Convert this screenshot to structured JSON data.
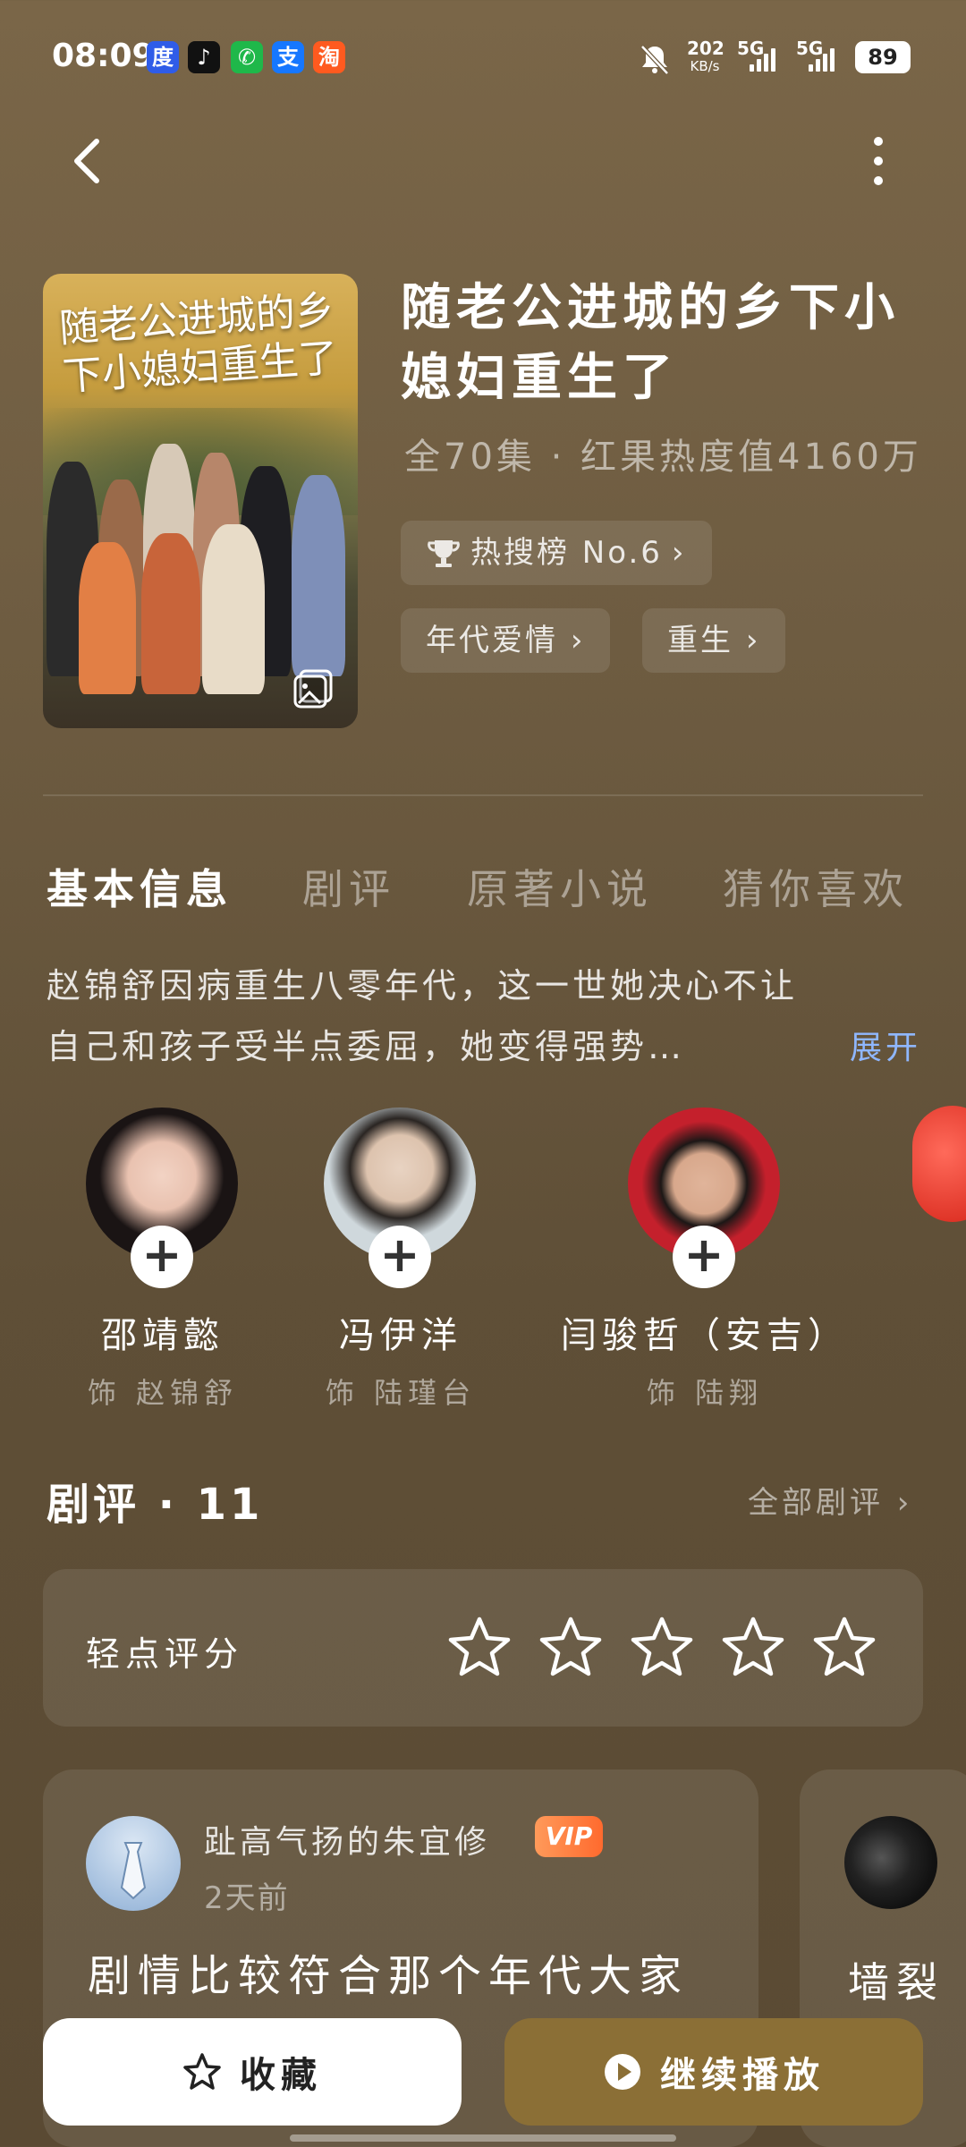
{
  "status_bar": {
    "time": "08:09",
    "apps": [
      "baidu-icon",
      "douyin-icon",
      "wechat-icon",
      "alipay-icon",
      "taobao-icon"
    ],
    "net_speed_value": "202",
    "net_speed_unit": "KB/s",
    "sim1": "5G",
    "sim2": "5G",
    "battery": "89"
  },
  "show": {
    "title": "随老公进城的乡下小媳妇重生了",
    "poster_title": "随老公进城的乡下小媳妇重生了",
    "meta": "全70集 · 红果热度值4160万",
    "rank_chip": "热搜榜 No.6",
    "tags": [
      "年代爱情",
      "重生"
    ]
  },
  "tabs": [
    "基本信息",
    "剧评",
    "原著小说",
    "猜你喜欢"
  ],
  "synopsis": {
    "line1": "赵锦舒因病重生八零年代，这一世她决心不让",
    "line2": "自己和孩子受半点委屈，她变得强势…",
    "expand": "展开"
  },
  "cast": [
    {
      "name": "邵靖懿",
      "role": "饰 赵锦舒"
    },
    {
      "name": "冯伊洋",
      "role": "饰 陆瑾台"
    },
    {
      "name": "闫骏哲（安吉）",
      "role": "饰 陆翔"
    }
  ],
  "reviews_section": {
    "title": "剧评 · 11",
    "all_link": "全部剧评 ›",
    "rate_label": "轻点评分",
    "stars": 5,
    "rating_value": 0
  },
  "review_cards": [
    {
      "user": "趾高气扬的朱宜修",
      "badge": "VIP",
      "time": "2天前",
      "text": "剧情比较符合那个年代大家"
    },
    {
      "text": "墙裂"
    }
  ],
  "bottom_bar": {
    "favorite": "收藏",
    "play": "继续播放"
  },
  "colors": {
    "background": "#6e5c41",
    "accent_blue": "#8fb7ff",
    "play_button": "#8b6f36",
    "vip_badge": "#ff7a3a"
  }
}
